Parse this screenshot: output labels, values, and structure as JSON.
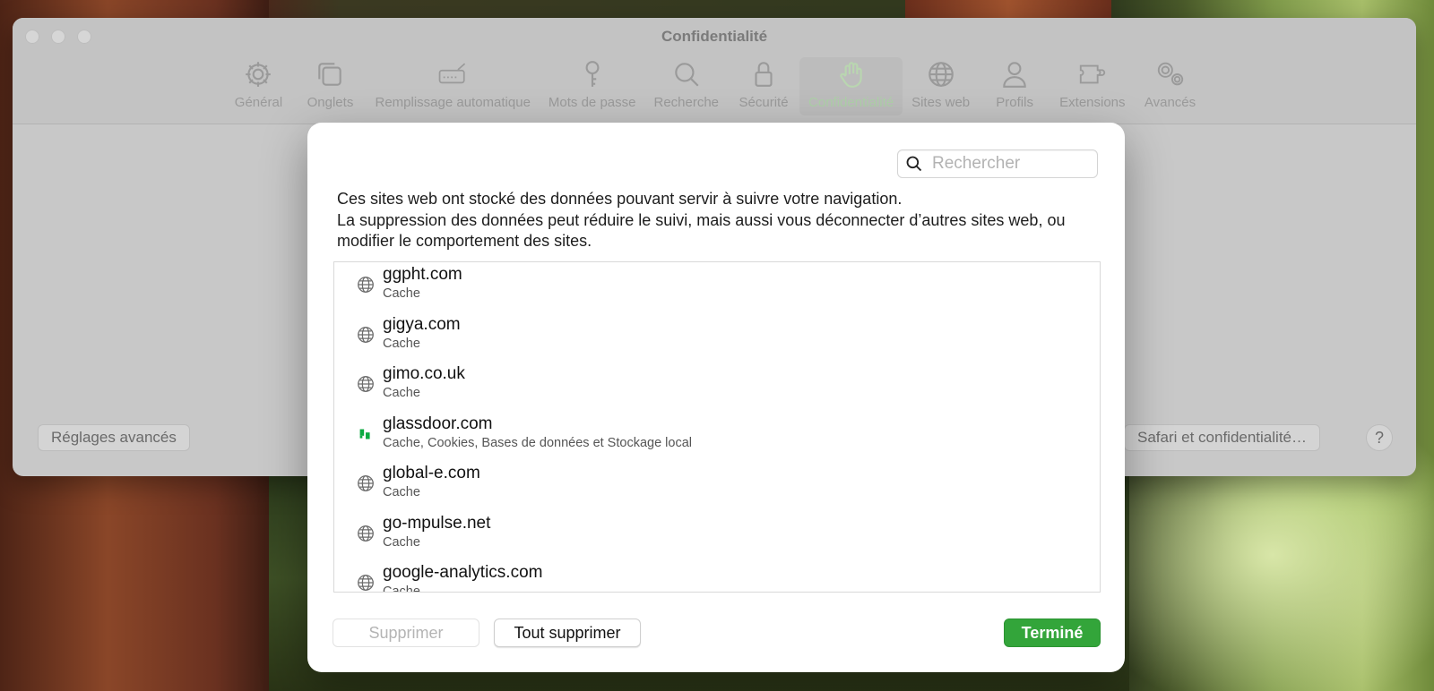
{
  "window": {
    "title": "Confidentialité"
  },
  "toolbar": {
    "items": [
      {
        "label": "Général",
        "icon": "gear-icon"
      },
      {
        "label": "Onglets",
        "icon": "tabs-icon"
      },
      {
        "label": "Remplissage automatique",
        "icon": "autofill-icon"
      },
      {
        "label": "Mots de passe",
        "icon": "key-icon"
      },
      {
        "label": "Recherche",
        "icon": "search-icon"
      },
      {
        "label": "Sécurité",
        "icon": "lock-icon"
      },
      {
        "label": "Confidentialité",
        "icon": "hand-icon",
        "active": true
      },
      {
        "label": "Sites web",
        "icon": "globe-icon"
      },
      {
        "label": "Profils",
        "icon": "person-icon"
      },
      {
        "label": "Extensions",
        "icon": "puzzle-icon"
      },
      {
        "label": "Avancés",
        "icon": "gears-icon"
      }
    ]
  },
  "prefs_buttons": {
    "advanced": "Réglages avancés",
    "safari_privacy": "Safari et confidentialité…",
    "help": "?"
  },
  "sheet": {
    "search_placeholder": "Rechercher",
    "description_line1": "Ces sites web ont stocké des données pouvant servir à suivre votre navigation.",
    "description_line2": "La suppression des données peut réduire le suivi, mais aussi vous déconnecter d’autres sites web, ou modifier le comportement des sites.",
    "sites": [
      {
        "domain": "ggpht.com",
        "kind": "Cache",
        "icon": "globe-icon"
      },
      {
        "domain": "gigya.com",
        "kind": "Cache",
        "icon": "globe-icon"
      },
      {
        "domain": "gimo.co.uk",
        "kind": "Cache",
        "icon": "globe-icon"
      },
      {
        "domain": "glassdoor.com",
        "kind": "Cache, Cookies, Bases de données et Stockage local",
        "icon": "glassdoor-icon"
      },
      {
        "domain": "global-e.com",
        "kind": "Cache",
        "icon": "globe-icon"
      },
      {
        "domain": "go-mpulse.net",
        "kind": "Cache",
        "icon": "globe-icon"
      },
      {
        "domain": "google-analytics.com",
        "kind": "Cache",
        "icon": "globe-icon"
      }
    ],
    "buttons": {
      "delete": "Supprimer",
      "delete_all": "Tout supprimer",
      "done": "Terminé"
    }
  },
  "colors": {
    "accent_green": "#33a53a",
    "active_tab_tint": "#aed0a8"
  }
}
